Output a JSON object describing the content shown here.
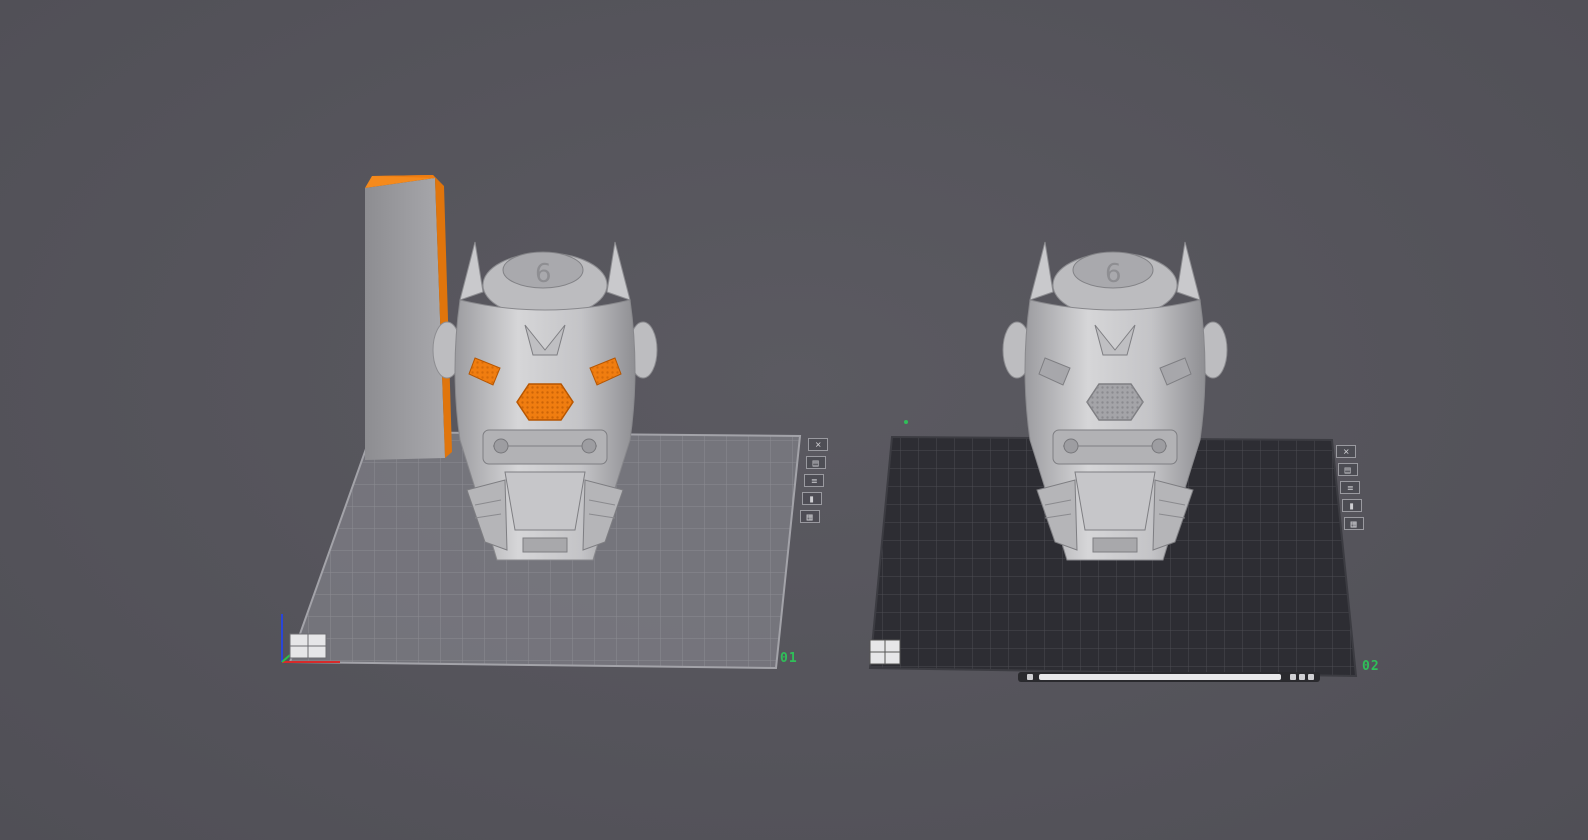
{
  "scene": {
    "background": "#55545b",
    "accent_color": "#f07d10",
    "label_color": "#2fbf59"
  },
  "plates": [
    {
      "label": "01",
      "surface": "light-grey-grid",
      "selected_model": true,
      "buttons": [
        "close-icon",
        "arrange-icon",
        "layers-icon",
        "lock-icon",
        "settings-icon"
      ]
    },
    {
      "label": "02",
      "surface": "textured-dark-pei-grid",
      "selected_model": false,
      "buttons": [
        "close-icon",
        "arrange-icon",
        "layers-icon",
        "lock-icon",
        "settings-icon"
      ]
    }
  ],
  "models": [
    {
      "name": "mech-helmet-can-holder",
      "plate": "01",
      "highlight": "orange"
    },
    {
      "name": "mech-helmet-can-holder",
      "plate": "02",
      "highlight": "none"
    }
  ],
  "wipe_tower": {
    "plate": "01",
    "color": "#f07d10"
  },
  "axis_gizmo": [
    "x-axis",
    "y-axis",
    "z-axis"
  ]
}
